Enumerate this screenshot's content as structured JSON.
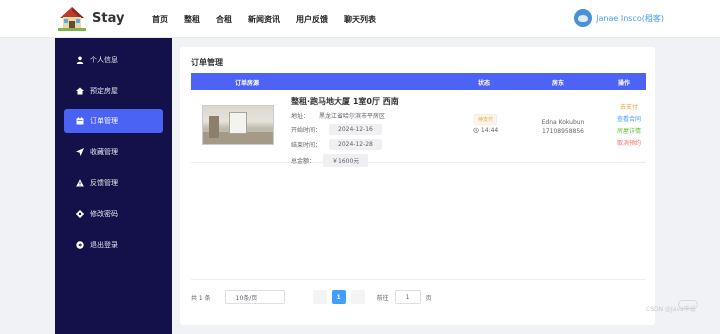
{
  "header": {
    "logo_text": "Stay",
    "nav": [
      "首页",
      "整租",
      "合租",
      "新闻资讯",
      "用户反馈",
      "聊天列表"
    ],
    "user_name": "Janae Insco(租客)"
  },
  "sidebar": {
    "items": [
      {
        "label": "个人信息",
        "icon": "user-icon"
      },
      {
        "label": "预定房屋",
        "icon": "home-icon"
      },
      {
        "label": "订单管理",
        "icon": "calendar-icon",
        "active": true
      },
      {
        "label": "收藏管理",
        "icon": "send-icon"
      },
      {
        "label": "反馈管理",
        "icon": "warning-icon"
      },
      {
        "label": "修改密码",
        "icon": "gear-icon"
      },
      {
        "label": "退出登录",
        "icon": "logout-icon"
      }
    ]
  },
  "main": {
    "title": "订单管理",
    "columns": [
      "订单房源",
      "状态",
      "房东",
      "操作"
    ],
    "order": {
      "house_title": "整租·跑马地大厦 1室0厅 西南",
      "address_label": "地址：",
      "address": "黑龙江省哈尔滨市平房区",
      "start_label": "开始时间：",
      "start_date": "2024-12-16",
      "end_label": "结束时间：",
      "end_date": "2024-12-28",
      "total_label": "总金额：",
      "total": "￥1600元",
      "status_badge": "待支付",
      "status_time": "14:44",
      "landlord_name": "Edna Kokubun",
      "landlord_phone": "17108958856",
      "ops": [
        "去支付",
        "查看合同",
        "房屋详情",
        "取消预约"
      ]
    },
    "pagination": {
      "total_text": "共 1 条",
      "page_size": "10条/页",
      "current_page": "1",
      "goto_label": "前往",
      "goto_value": "1",
      "goto_suffix": "页"
    }
  },
  "watermark": "CSDN @Java毕设",
  "colors": {
    "sidebar_bg": "#141049",
    "accent": "#4a63f5",
    "pay": "#e6a23c",
    "contract": "#409eff",
    "detail": "#67c23a",
    "cancel": "#f56c6c"
  }
}
